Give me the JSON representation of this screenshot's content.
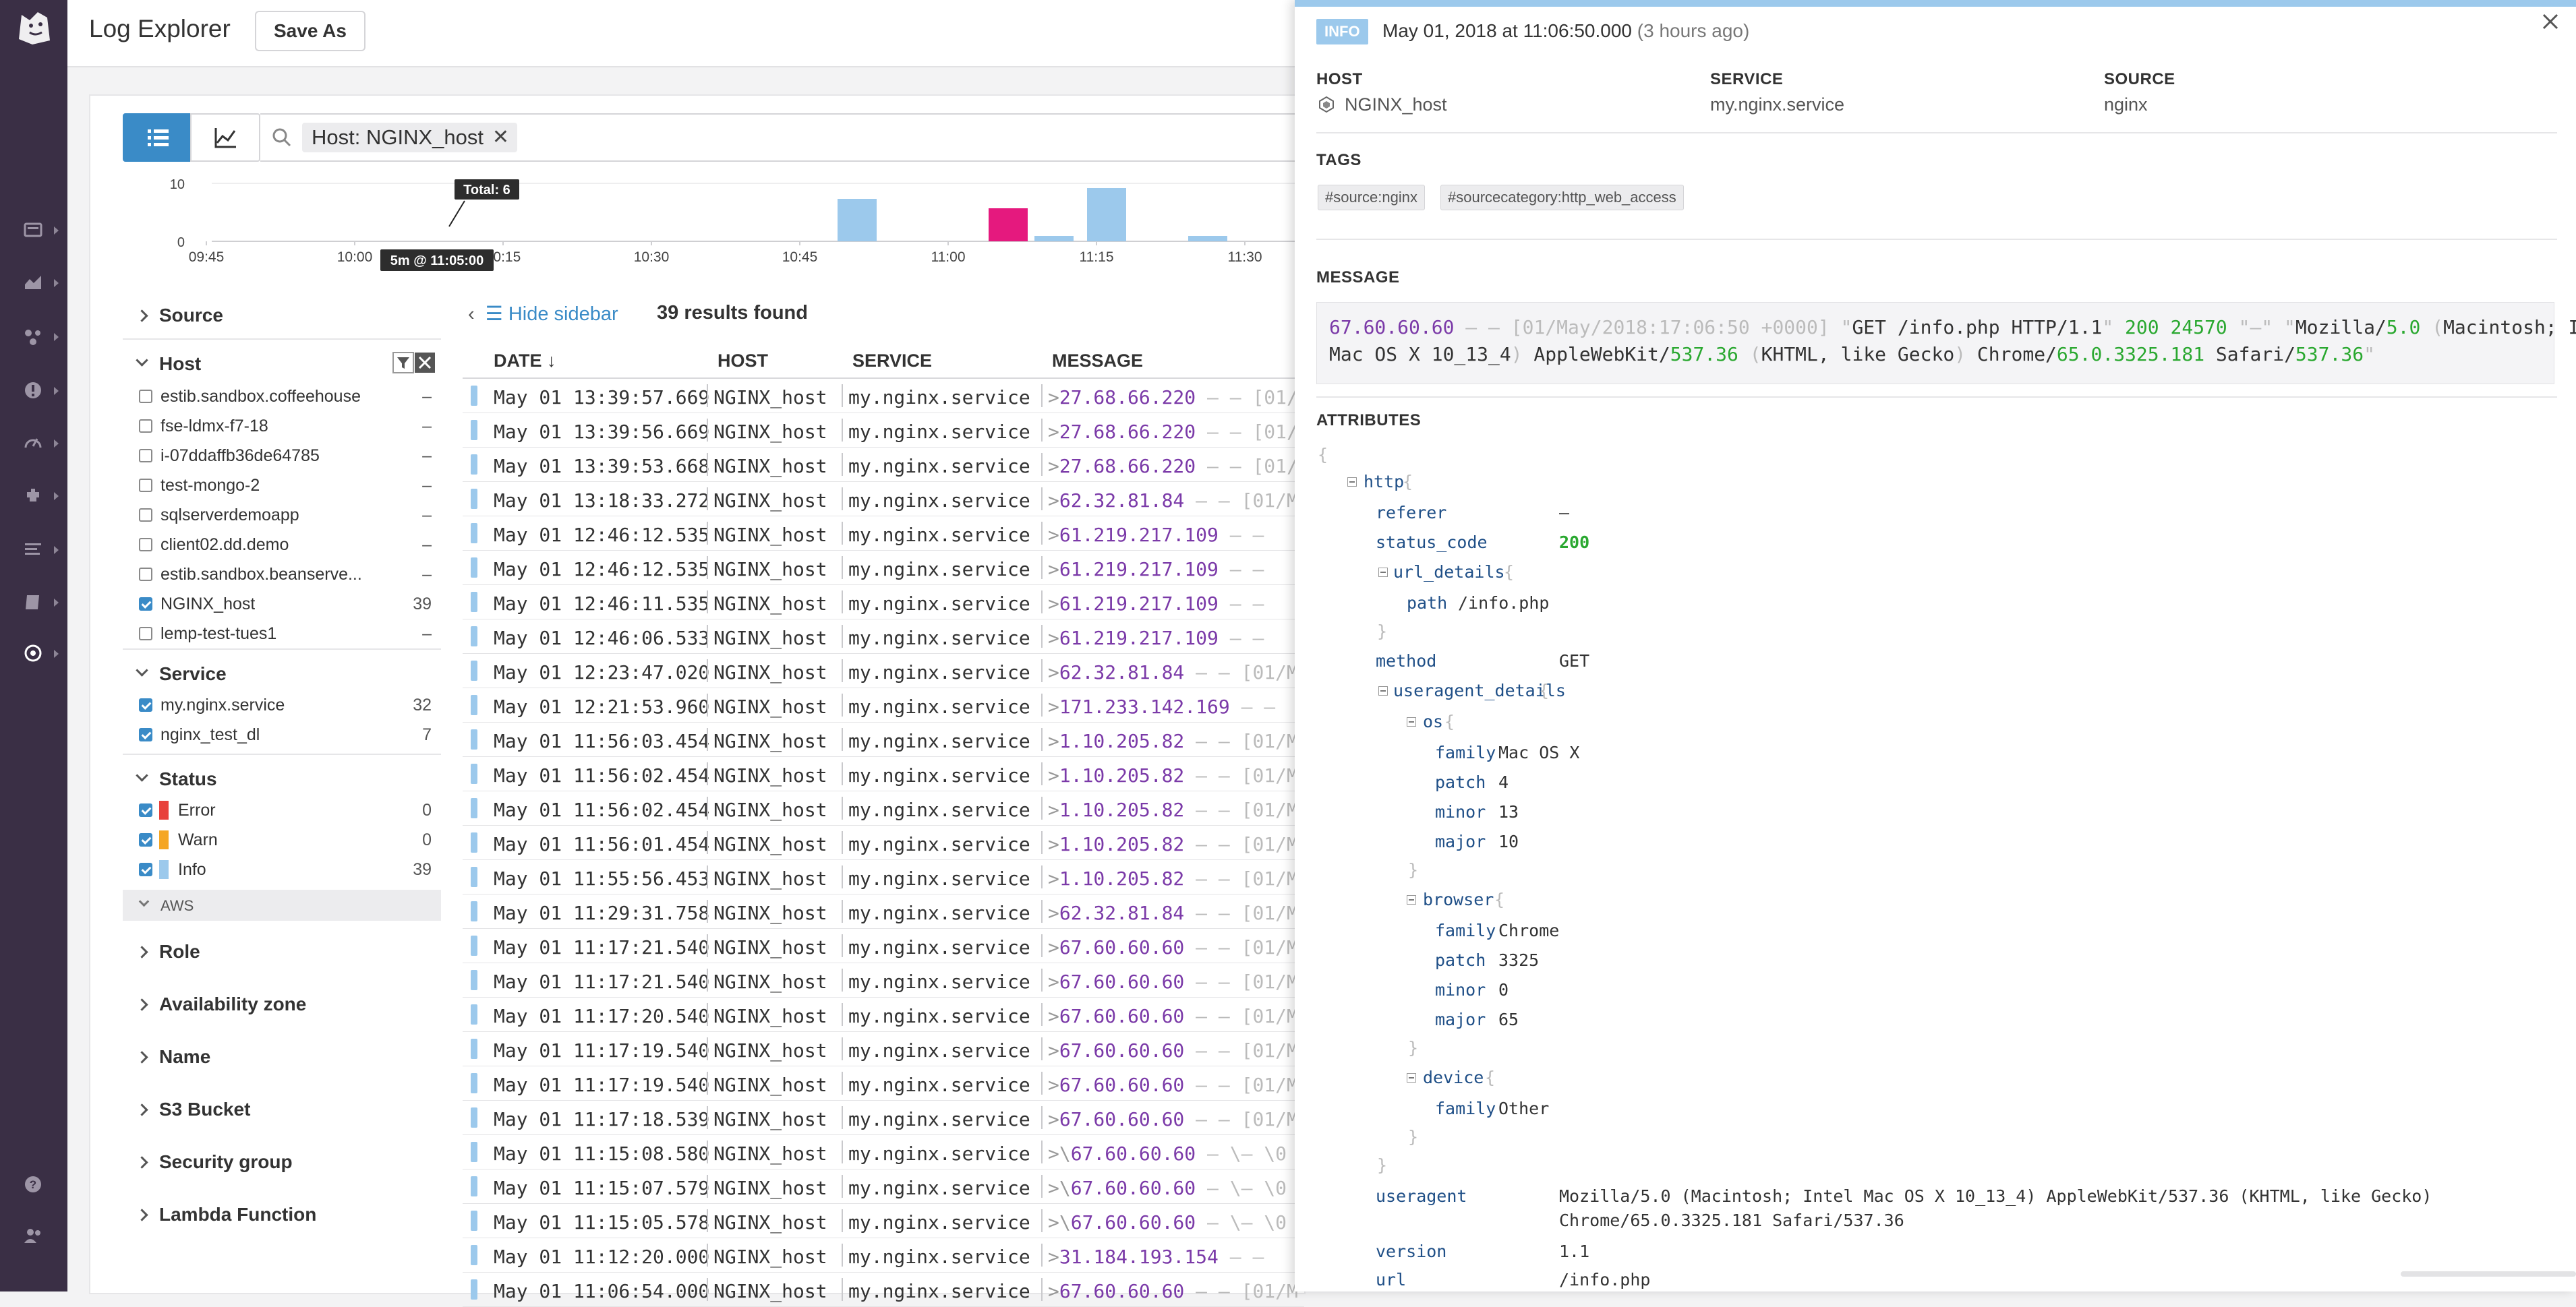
{
  "app": {
    "title": "Log Explorer",
    "save_as": "Save As"
  },
  "colors": {
    "nav_bg": "#3a2f45",
    "accent": "#3a8bc7",
    "info": "#9cc9ec",
    "error": "#e8413b",
    "warn": "#f5a623",
    "selected_bar": "#e5197e"
  },
  "nav_icons": [
    "dashboard-icon",
    "metrics-icon",
    "integrations-icon",
    "monitors-icon",
    "apm-icon",
    "infrastructure-icon",
    "logs-icon",
    "notebooks-icon",
    "watchdog-icon",
    "help-icon",
    "team-icon"
  ],
  "search": {
    "chip": "Host: NGINX_host"
  },
  "histogram": {
    "y_ticks": [
      "10",
      "0"
    ],
    "x_ticks": [
      "09:45",
      "10:00",
      "10:15",
      "10:30",
      "10:45",
      "11:00",
      "11:15",
      "11:30"
    ],
    "tooltip_total": "Total: 6",
    "tooltip_time": "5m @ 11:05:00"
  },
  "facets": {
    "source": "Source",
    "host": {
      "title": "Host",
      "items": [
        {
          "label": "estib.sandbox.coffeehouse",
          "count": "–",
          "checked": false
        },
        {
          "label": "fse-ldmx-f7-18",
          "count": "–",
          "checked": false
        },
        {
          "label": "i-07ddaffb36de64785",
          "count": "–",
          "checked": false
        },
        {
          "label": "test-mongo-2",
          "count": "–",
          "checked": false
        },
        {
          "label": "sqlserverdemoapp",
          "count": "–",
          "checked": false
        },
        {
          "label": "client02.dd.demo",
          "count": "–",
          "checked": false
        },
        {
          "label": "estib.sandbox.beanserve...",
          "count": "–",
          "checked": false
        },
        {
          "label": "NGINX_host",
          "count": "39",
          "checked": true
        },
        {
          "label": "lemp-test-tues1",
          "count": "–",
          "checked": false
        }
      ]
    },
    "service": {
      "title": "Service",
      "items": [
        {
          "label": "my.nginx.service",
          "count": "32",
          "checked": true
        },
        {
          "label": "nginx_test_dl",
          "count": "7",
          "checked": true
        }
      ]
    },
    "status": {
      "title": "Status",
      "items": [
        {
          "label": "Error",
          "count": "0",
          "checked": true
        },
        {
          "label": "Warn",
          "count": "0",
          "checked": true
        },
        {
          "label": "Info",
          "count": "39",
          "checked": true
        }
      ]
    },
    "aws": "AWS",
    "collapsed": [
      "Role",
      "Availability zone",
      "Name",
      "S3 Bucket",
      "Security group",
      "Lambda Function"
    ]
  },
  "results": {
    "hide_sidebar": "Hide sidebar",
    "count": "39 results found",
    "columns": [
      "DATE ↓",
      "HOST",
      "SERVICE",
      "MESSAGE"
    ],
    "rows": [
      {
        "date": "May 01 13:39:57.669",
        "host": "NGINX_host",
        "service": "my.nginx.service",
        "prefix": ">",
        "ip": "27.68.66.220",
        "rest": " –  –  [01/"
      },
      {
        "date": "May 01 13:39:56.669",
        "host": "NGINX_host",
        "service": "my.nginx.service",
        "prefix": ">",
        "ip": "27.68.66.220",
        "rest": " –  –  [01/M"
      },
      {
        "date": "May 01 13:39:53.668",
        "host": "NGINX_host",
        "service": "my.nginx.service",
        "prefix": ">",
        "ip": "27.68.66.220",
        "rest": " –  –  [01/M"
      },
      {
        "date": "May 01 13:18:33.272",
        "host": "NGINX_host",
        "service": "my.nginx.service",
        "prefix": ">",
        "ip": "62.32.81.84",
        "rest": " –  –  [01/M"
      },
      {
        "date": "May 01 12:46:12.535",
        "host": "NGINX_host",
        "service": "my.nginx.service",
        "prefix": ">",
        "ip": "61.219.217.109",
        "rest": " –  –"
      },
      {
        "date": "May 01 12:46:12.535",
        "host": "NGINX_host",
        "service": "my.nginx.service",
        "prefix": ">",
        "ip": "61.219.217.109",
        "rest": " –  –"
      },
      {
        "date": "May 01 12:46:11.535",
        "host": "NGINX_host",
        "service": "my.nginx.service",
        "prefix": ">",
        "ip": "61.219.217.109",
        "rest": " –  –"
      },
      {
        "date": "May 01 12:46:06.533",
        "host": "NGINX_host",
        "service": "my.nginx.service",
        "prefix": ">",
        "ip": "61.219.217.109",
        "rest": " –  –"
      },
      {
        "date": "May 01 12:23:47.020",
        "host": "NGINX_host",
        "service": "my.nginx.service",
        "prefix": ">",
        "ip": "62.32.81.84",
        "rest": " –  –  [01/M"
      },
      {
        "date": "May 01 12:21:53.960",
        "host": "NGINX_host",
        "service": "my.nginx.service",
        "prefix": ">",
        "ip": "171.233.142.169",
        "rest": " –  –"
      },
      {
        "date": "May 01 11:56:03.454",
        "host": "NGINX_host",
        "service": "my.nginx.service",
        "prefix": ">",
        "ip": "1.10.205.82",
        "rest": " –  –  [01/M"
      },
      {
        "date": "May 01 11:56:02.454",
        "host": "NGINX_host",
        "service": "my.nginx.service",
        "prefix": ">",
        "ip": "1.10.205.82",
        "rest": " –  –  [01/M"
      },
      {
        "date": "May 01 11:56:02.454",
        "host": "NGINX_host",
        "service": "my.nginx.service",
        "prefix": ">",
        "ip": "1.10.205.82",
        "rest": " –  –  [01/M"
      },
      {
        "date": "May 01 11:56:01.454",
        "host": "NGINX_host",
        "service": "my.nginx.service",
        "prefix": ">",
        "ip": "1.10.205.82",
        "rest": " –  –  [01/M"
      },
      {
        "date": "May 01 11:55:56.453",
        "host": "NGINX_host",
        "service": "my.nginx.service",
        "prefix": ">",
        "ip": "1.10.205.82",
        "rest": " –  –  [01/M"
      },
      {
        "date": "May 01 11:29:31.758",
        "host": "NGINX_host",
        "service": "my.nginx.service",
        "prefix": ">",
        "ip": "62.32.81.84",
        "rest": " –  –  [01/M"
      },
      {
        "date": "May 01 11:17:21.540",
        "host": "NGINX_host",
        "service": "my.nginx.service",
        "prefix": ">",
        "ip": "67.60.60.60",
        "rest": " –  –  [01/M"
      },
      {
        "date": "May 01 11:17:21.540",
        "host": "NGINX_host",
        "service": "my.nginx.service",
        "prefix": ">",
        "ip": "67.60.60.60",
        "rest": " –  –  [01/M"
      },
      {
        "date": "May 01 11:17:20.540",
        "host": "NGINX_host",
        "service": "my.nginx.service",
        "prefix": ">",
        "ip": "67.60.60.60",
        "rest": " –  –  [01/M"
      },
      {
        "date": "May 01 11:17:19.540",
        "host": "NGINX_host",
        "service": "my.nginx.service",
        "prefix": ">",
        "ip": "67.60.60.60",
        "rest": " –  –  [01/M"
      },
      {
        "date": "May 01 11:17:19.540",
        "host": "NGINX_host",
        "service": "my.nginx.service",
        "prefix": ">",
        "ip": "67.60.60.60",
        "rest": " –  –  [01/M"
      },
      {
        "date": "May 01 11:17:18.539",
        "host": "NGINX_host",
        "service": "my.nginx.service",
        "prefix": ">",
        "ip": "67.60.60.60",
        "rest": " –  –  [01/M"
      },
      {
        "date": "May 01 11:15:08.580",
        "host": "NGINX_host",
        "service": "my.nginx.service",
        "prefix": ">\\",
        "ip": "67.60.60.60",
        "rest": "  –  \\–   \\0"
      },
      {
        "date": "May 01 11:15:07.579",
        "host": "NGINX_host",
        "service": "my.nginx.service",
        "prefix": ">\\",
        "ip": "67.60.60.60",
        "rest": "  –   \\–   \\0"
      },
      {
        "date": "May 01 11:15:05.578",
        "host": "NGINX_host",
        "service": "my.nginx.service",
        "prefix": ">\\",
        "ip": "67.60.60.60",
        "rest": "  –  \\–   \\0"
      },
      {
        "date": "May 01 11:12:20.000",
        "host": "NGINX_host",
        "service": "my.nginx.service",
        "prefix": ">",
        "ip": "31.184.193.154",
        "rest": " –  –"
      },
      {
        "date": "May 01 11:06:54.000",
        "host": "NGINX_host",
        "service": "my.nginx.service",
        "prefix": ">",
        "ip": "67.60.60.60",
        "rest": " –  –  [01/M"
      }
    ]
  },
  "detail": {
    "status": "INFO",
    "timestamp": "May 01, 2018 at 11:06:50.000",
    "ago": "(3 hours ago)",
    "host_label": "HOST",
    "host": "NGINX_host",
    "service_label": "SERVICE",
    "service": "my.nginx.service",
    "source_label": "SOURCE",
    "source": "nginx",
    "tags_label": "TAGS",
    "tags": [
      "#source:nginx",
      "#sourcecategory:http_web_access"
    ],
    "message_label": "MESSAGE",
    "attributes_label": "ATTRIBUTES",
    "attrs": {
      "http": "http",
      "referer_k": "referer",
      "referer_v": "–",
      "status_code_k": "status_code",
      "status_code_v": "200",
      "url_details": "url_details",
      "path_k": "path",
      "path_v": "/info.php",
      "method_k": "method",
      "method_v": "GET",
      "useragent_details": "useragent_details",
      "os": "os",
      "os_family_k": "family",
      "os_family_v": "Mac OS X",
      "os_patch_k": "patch",
      "os_patch_v": "4",
      "os_minor_k": "minor",
      "os_minor_v": "13",
      "os_major_k": "major",
      "os_major_v": "10",
      "browser": "browser",
      "br_family_k": "family",
      "br_family_v": "Chrome",
      "br_patch_k": "patch",
      "br_patch_v": "3325",
      "br_minor_k": "minor",
      "br_minor_v": "0",
      "br_major_k": "major",
      "br_major_v": "65",
      "device": "device",
      "dev_family_k": "family",
      "dev_family_v": "Other",
      "useragent_k": "useragent",
      "useragent_v1": "Mozilla/5.0 (Macintosh; Intel Mac OS X 10_13_4) AppleWebKit/537.36 (KHTML, like Gecko)",
      "useragent_v2": "Chrome/65.0.3325.181 Safari/537.36",
      "version_k": "version",
      "version_v": "1.1",
      "url_k": "url",
      "url_v": "/info.php"
    }
  }
}
